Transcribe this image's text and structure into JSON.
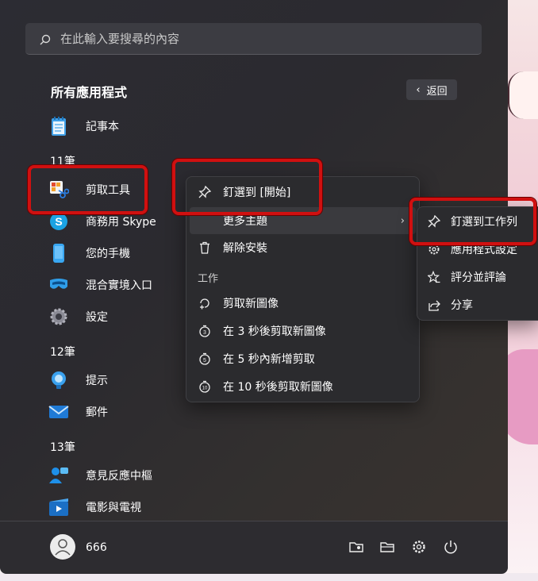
{
  "search": {
    "placeholder": "在此輸入要搜尋的內容"
  },
  "all_apps": {
    "title": "所有應用程式",
    "back_label": "返回"
  },
  "apps": [
    {
      "group": null,
      "label": "記事本",
      "icon": "notepad-icon"
    },
    {
      "group": "11筆"
    },
    {
      "label": "剪取工具",
      "icon": "snipping-tool-icon"
    },
    {
      "label": "商務用 Skype",
      "icon": "skype-icon"
    },
    {
      "label": "您的手機",
      "icon": "phone-icon"
    },
    {
      "label": "混合實境入口",
      "icon": "mixed-reality-icon"
    },
    {
      "label": "設定",
      "icon": "settings-gear-icon"
    },
    {
      "group": "12筆"
    },
    {
      "label": "提示",
      "icon": "tips-icon"
    },
    {
      "label": "郵件",
      "icon": "mail-icon"
    },
    {
      "group": "13筆"
    },
    {
      "label": "意見反應中樞",
      "icon": "feedback-hub-icon"
    },
    {
      "label": "電影與電視",
      "icon": "movies-tv-icon"
    }
  ],
  "labels": {
    "notepad": "記事本",
    "group11": "11筆",
    "snip": "剪取工具",
    "skype": "商務用 Skype",
    "phone": "您的手機",
    "mixed": "混合實境入口",
    "settings": "設定",
    "group12": "12筆",
    "tips": "提示",
    "mail": "郵件",
    "group13": "13筆",
    "feedback": "意見反應中樞",
    "movies": "電影與電視"
  },
  "context_menu": {
    "pin_start": "釘選到 [開始]",
    "more": "更多主題",
    "uninstall": "解除安裝",
    "section_work": "工作",
    "new_snip": "剪取新圖像",
    "snip_3s": "在 3 秒後剪取新圖像",
    "snip_5s": "在 5 秒內新增剪取",
    "snip_10s": "在 10 秒後剪取新圖像"
  },
  "submenu": {
    "pin_taskbar": "釘選到工作列",
    "app_settings": "應用程式設定",
    "rate": "評分並評論",
    "share": "分享"
  },
  "user": {
    "name": "666"
  },
  "colors": {
    "highlight_box": "#d01010",
    "menu_bg": "#2b2b2e"
  }
}
